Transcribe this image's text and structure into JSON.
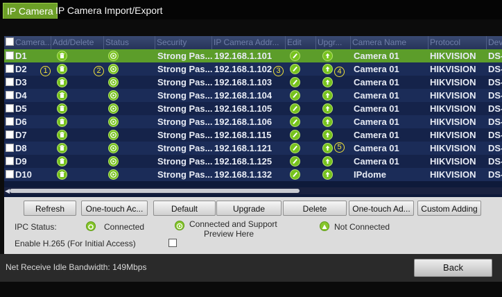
{
  "tabs": [
    {
      "label": "IP Camera",
      "active": true
    },
    {
      "label": "IP Camera Import/Export",
      "active": false
    }
  ],
  "table": {
    "columns": [
      "Camera...",
      "Add/Delete",
      "Status",
      "Security",
      "IP Camera Addr...",
      "Edit",
      "Upgr...",
      "Camera Name",
      "Protocol",
      "Devi..."
    ],
    "rows": [
      {
        "id": "D1",
        "security": "Strong Pas...",
        "ip": "192.168.1.101",
        "name": "Camera 01",
        "protocol": "HIKVISION",
        "device": "DS-",
        "selected": true
      },
      {
        "id": "D2",
        "security": "Strong Pas...",
        "ip": "192.168.1.102",
        "name": "Camera 01",
        "protocol": "HIKVISION",
        "device": "DS-",
        "selected": false
      },
      {
        "id": "D3",
        "security": "Strong Pas...",
        "ip": "192.168.1.103",
        "name": "Camera 01",
        "protocol": "HIKVISION",
        "device": "DS-",
        "selected": false
      },
      {
        "id": "D4",
        "security": "Strong Pas...",
        "ip": "192.168.1.104",
        "name": "Camera 01",
        "protocol": "HIKVISION",
        "device": "DS-",
        "selected": false
      },
      {
        "id": "D5",
        "security": "Strong Pas...",
        "ip": "192.168.1.105",
        "name": "Camera 01",
        "protocol": "HIKVISION",
        "device": "DS-",
        "selected": false
      },
      {
        "id": "D6",
        "security": "Strong Pas...",
        "ip": "192.168.1.106",
        "name": "Camera 01",
        "protocol": "HIKVISION",
        "device": "DS-",
        "selected": false
      },
      {
        "id": "D7",
        "security": "Strong Pas...",
        "ip": "192.168.1.115",
        "name": "Camera 01",
        "protocol": "HIKVISION",
        "device": "DS-",
        "selected": false
      },
      {
        "id": "D8",
        "security": "Strong Pas...",
        "ip": "192.168.1.121",
        "name": "Camera 01",
        "protocol": "HIKVISION",
        "device": "DS-",
        "selected": false
      },
      {
        "id": "D9",
        "security": "Strong Pas...",
        "ip": "192.168.1.125",
        "name": "Camera 01",
        "protocol": "HIKVISION",
        "device": "DS-",
        "selected": false
      },
      {
        "id": "D10",
        "security": "Strong Pas...",
        "ip": "192.168.1.132",
        "name": "IPdome",
        "protocol": "HIKVISION",
        "device": "DS-",
        "selected": false
      }
    ]
  },
  "callouts": [
    "1",
    "2",
    "3",
    "4",
    "5"
  ],
  "buttons": {
    "refresh": "Refresh",
    "one_touch_activate": "One-touch Ac...",
    "default": "Default",
    "upgrade": "Upgrade",
    "delete": "Delete",
    "one_touch_add": "One-touch Ad...",
    "custom_adding": "Custom Adding",
    "back": "Back"
  },
  "legend": {
    "ipc_status_label": "IPC Status:",
    "connected": "Connected",
    "connected_support_line1": "Connected and Support",
    "connected_support_line2": "Preview Here",
    "not_connected": "Not Connected"
  },
  "h265": {
    "label": "Enable H.265 (For Initial Access)",
    "checked": false
  },
  "bandwidth": "Net Receive Idle Bandwidth: 149Mbps",
  "icons": {
    "delete": "trash-icon",
    "status": "play-icon",
    "edit": "pencil-icon",
    "upgrade": "up-arrow-icon"
  },
  "colors": {
    "accent_green": "#6c9f27",
    "selected_row": "#5c9d2a",
    "callout_yellow": "#f2e33a"
  }
}
